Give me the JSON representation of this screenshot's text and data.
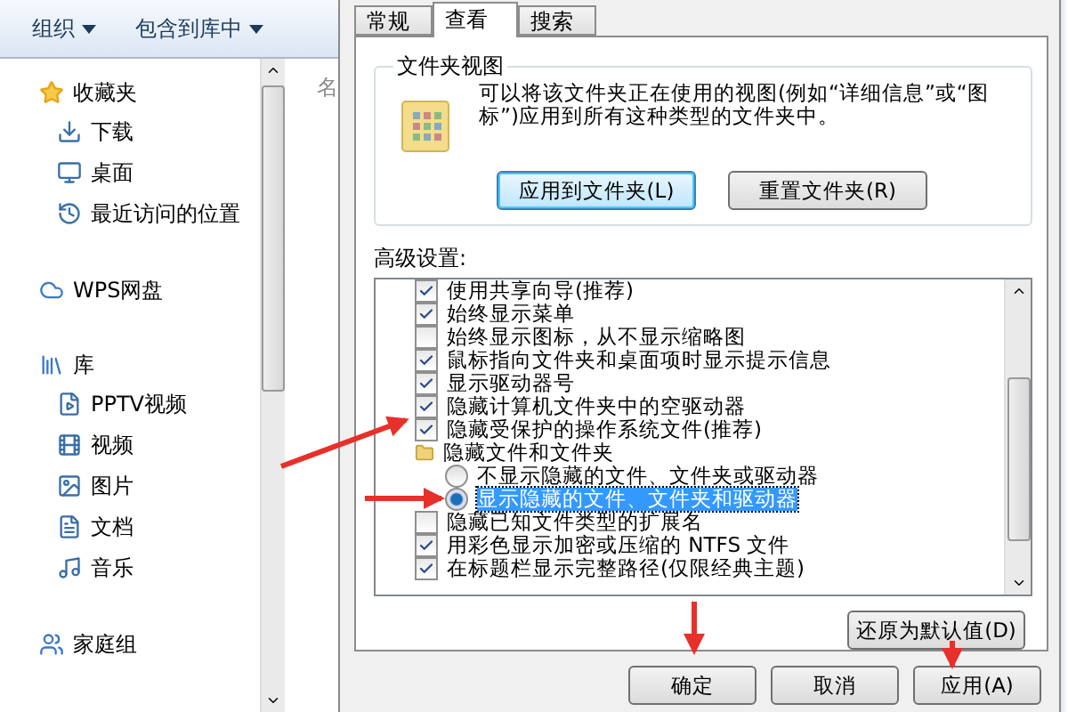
{
  "toolbar": [
    {
      "label": "组织"
    },
    {
      "label": "包含到库中"
    }
  ],
  "navigation": [
    {
      "label": "收藏夹",
      "children": [
        {
          "label": "下载"
        },
        {
          "label": "桌面"
        },
        {
          "label": "最近访问的位置"
        }
      ]
    },
    {
      "label": "WPS网盘"
    },
    {
      "label": "库",
      "children": [
        {
          "label": "PPTV视频"
        },
        {
          "label": "视频"
        },
        {
          "label": "图片"
        },
        {
          "label": "文档"
        },
        {
          "label": "音乐"
        }
      ]
    },
    {
      "label": "家庭组"
    }
  ],
  "file_list": {
    "column_1": "名"
  },
  "dialog": {
    "tabs": [
      {
        "label": "常规",
        "selected": false
      },
      {
        "label": "查看",
        "selected": true
      },
      {
        "label": "搜索",
        "selected": false
      }
    ],
    "folder_views": {
      "title": "文件夹视图",
      "description": "可以将该文件夹正在使用的视图(例如“详细信息”或“图标”)应用到所有这种类型的文件夹中。",
      "buttons": [
        {
          "label": "应用到文件夹(L)",
          "focused": true
        },
        {
          "label": "重置文件夹(R)",
          "focused": false
        }
      ]
    },
    "advanced_label": "高级设置:",
    "advanced_items": [
      {
        "kind": "checkbox",
        "label": "使用共享向导(推荐)",
        "checked": true
      },
      {
        "kind": "checkbox",
        "label": "始终显示菜单",
        "checked": true
      },
      {
        "kind": "checkbox",
        "label": "始终显示图标，从不显示缩略图",
        "checked": false
      },
      {
        "kind": "checkbox",
        "label": "鼠标指向文件夹和桌面项时显示提示信息",
        "checked": true
      },
      {
        "kind": "checkbox",
        "label": "显示驱动器号",
        "checked": true
      },
      {
        "kind": "checkbox",
        "label": "隐藏计算机文件夹中的空驱动器",
        "checked": true
      },
      {
        "kind": "checkbox",
        "label": "隐藏受保护的操作系统文件(推荐)",
        "checked": true
      },
      {
        "kind": "folder",
        "label": "隐藏文件和文件夹",
        "children": [
          {
            "kind": "radio",
            "label": "不显示隐藏的文件、文件夹或驱动器",
            "selected": false
          },
          {
            "kind": "radio",
            "label": "显示隐藏的文件、文件夹和驱动器",
            "selected": true
          }
        ]
      },
      {
        "kind": "checkbox",
        "label": "隐藏已知文件类型的扩展名",
        "checked": false
      },
      {
        "kind": "checkbox",
        "label": "用彩色显示加密或压缩的 NTFS 文件",
        "checked": true
      },
      {
        "kind": "checkbox",
        "label": "在标题栏显示完整路径(仅限经典主题)",
        "checked": true
      }
    ],
    "restore_button": "还原为默认值(D)",
    "footer_buttons": [
      "确定",
      "取消",
      "应用(A)"
    ]
  }
}
